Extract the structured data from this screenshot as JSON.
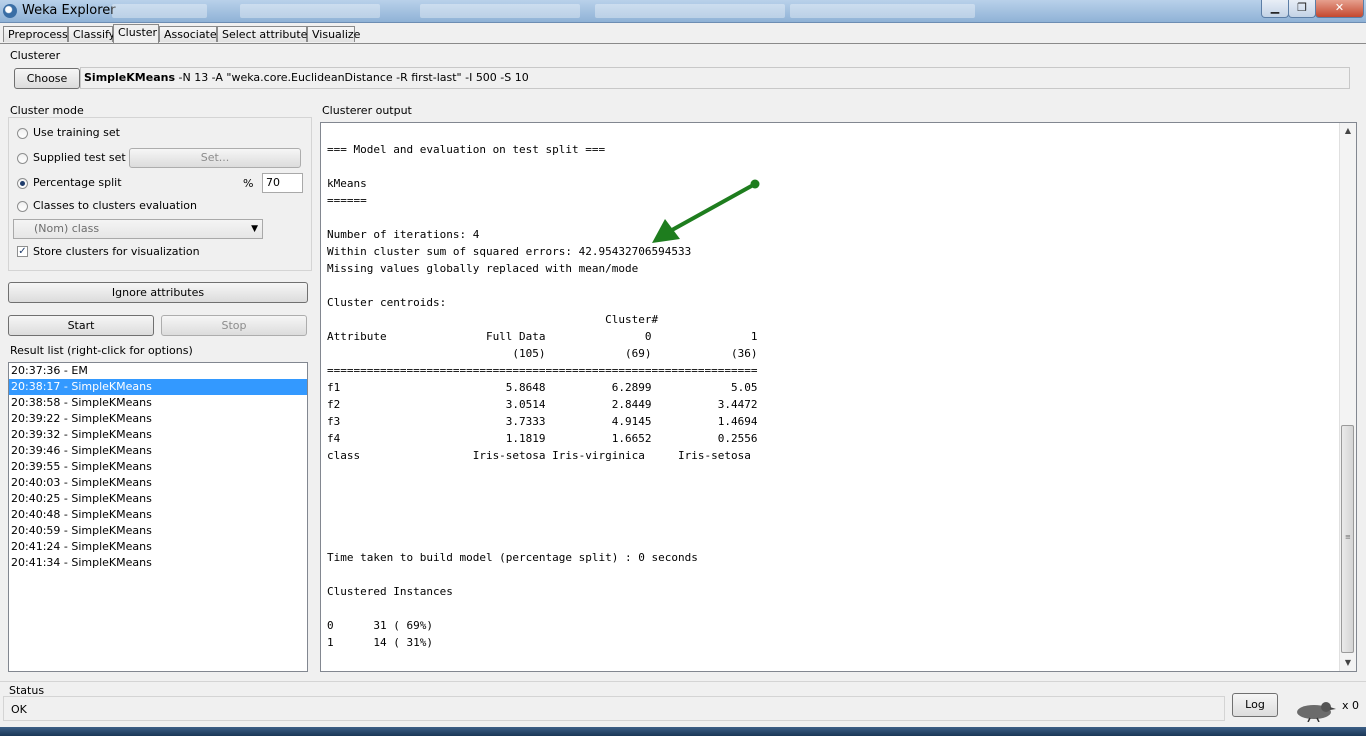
{
  "window": {
    "title": "Weka Explorer"
  },
  "tabs": [
    "Preprocess",
    "Classify",
    "Cluster",
    "Associate",
    "Select attributes",
    "Visualize"
  ],
  "clusterer": {
    "section_label": "Clusterer",
    "choose_label": "Choose",
    "name": "SimpleKMeans",
    "options": " -N 13 -A \"weka.core.EuclideanDistance -R first-last\" -I 500 -S 10"
  },
  "cluster_mode": {
    "label": "Cluster mode",
    "use_training": "Use training set",
    "supplied_test": "Supplied test set",
    "set_label": "Set...",
    "percentage_split": "Percentage split",
    "percent_sign": "%",
    "percent_value": "70",
    "classes_to_clusters": "Classes to clusters evaluation",
    "class_select": "(Nom) class",
    "store_clusters": "Store clusters for visualization"
  },
  "buttons": {
    "ignore_attributes": "Ignore attributes",
    "start": "Start",
    "stop": "Stop",
    "log": "Log"
  },
  "result_list": {
    "label": "Result list (right-click for options)",
    "items": [
      "20:37:36 - EM",
      "20:38:17 - SimpleKMeans",
      "20:38:58 - SimpleKMeans",
      "20:39:22 - SimpleKMeans",
      "20:39:32 - SimpleKMeans",
      "20:39:46 - SimpleKMeans",
      "20:39:55 - SimpleKMeans",
      "20:40:03 - SimpleKMeans",
      "20:40:25 - SimpleKMeans",
      "20:40:48 - SimpleKMeans",
      "20:40:59 - SimpleKMeans",
      "20:41:24 - SimpleKMeans",
      "20:41:34 - SimpleKMeans"
    ],
    "selected_index": 1
  },
  "output": {
    "label": "Clusterer output",
    "text": "=== Model and evaluation on test split ===\n\nkMeans\n======\n\nNumber of iterations: 4\nWithin cluster sum of squared errors: 42.95432706594533\nMissing values globally replaced with mean/mode\n\nCluster centroids:\n                                          Cluster#\nAttribute               Full Data               0               1\n                            (105)            (69)            (36)\n=================================================================\nf1                         5.8648          6.2899            5.05\nf2                         3.0514          2.8449          3.4472\nf3                         3.7333          4.9145          1.4694\nf4                         1.1819          1.6652          0.2556\nclass                 Iris-setosa Iris-virginica     Iris-setosa\n\n\n\n\n\nTime taken to build model (percentage split) : 0 seconds\n\nClustered Instances\n\n0      31 ( 69%)\n1      14 ( 31%)"
  },
  "status": {
    "label": "Status",
    "text": "OK",
    "count": "x 0"
  },
  "colors": {
    "selection": "#3399ff",
    "annotation_arrow": "#1e7d1e"
  }
}
